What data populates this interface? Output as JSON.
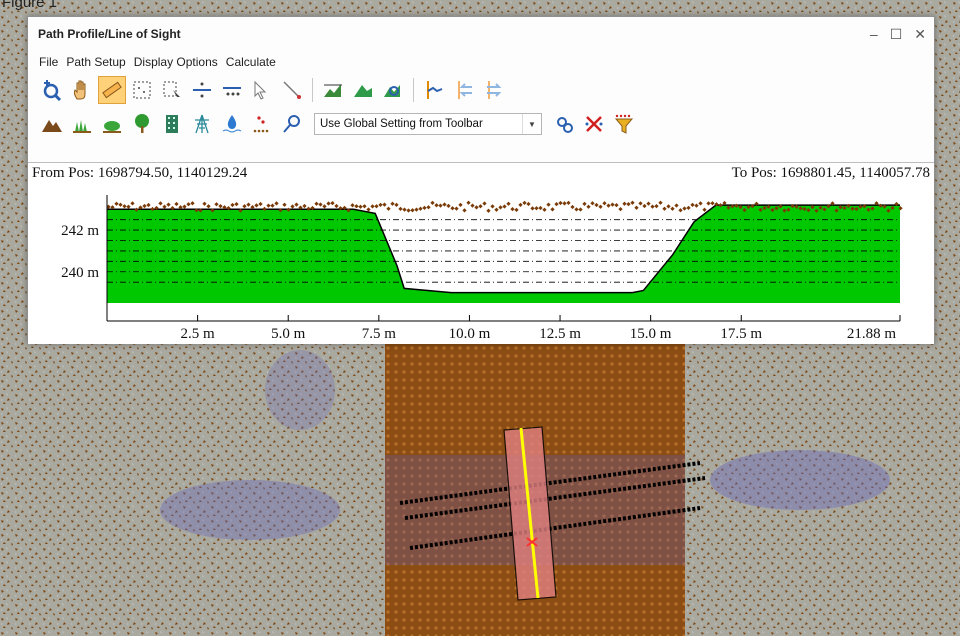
{
  "caption": "Figure 1",
  "window": {
    "title": "Path Profile/Line of Sight",
    "controls": {
      "minimize": "–",
      "maximize": "☐",
      "close": "✕"
    }
  },
  "menu": [
    "File",
    "Path Setup",
    "Display Options",
    "Calculate"
  ],
  "toolbar1": [
    {
      "icon": "zoom-plus-icon"
    },
    {
      "icon": "pan-hand-icon"
    },
    {
      "icon": "ruler-icon",
      "active": true
    },
    {
      "icon": "select-box-icon"
    },
    {
      "icon": "select-points-icon"
    },
    {
      "icon": "divide-icon"
    },
    {
      "icon": "divide-points-icon"
    },
    {
      "icon": "pointer-icon"
    },
    {
      "icon": "line-pointer-icon"
    },
    {
      "icon": "terrain-chart-icon"
    },
    {
      "icon": "terrain-fill-icon"
    },
    {
      "icon": "terrain-zoom-icon"
    },
    {
      "icon": "profile-line-icon"
    },
    {
      "icon": "profile-arrow-left-icon"
    },
    {
      "icon": "profile-arrow-right-icon"
    }
  ],
  "toolbar2": {
    "icons_left": [
      "terrain-icon",
      "grass-icon",
      "shrub-icon",
      "tree-icon",
      "building-icon",
      "tower-icon",
      "water-icon",
      "points-icon",
      "pin-icon"
    ],
    "dropdown_value": "Use Global Setting from Toolbar",
    "icons_right": [
      "settings-gear-icon",
      "clear-x-icon",
      "filter-icon"
    ]
  },
  "profile": {
    "from_pos": "From Pos: 1698794.50, 1140129.24",
    "to_pos": "To Pos: 1698801.45, 1140057.78",
    "y_ticks": [
      "242 m",
      "240 m"
    ],
    "x_ticks": [
      "2.5 m",
      "5.0 m",
      "7.5 m",
      "10.0 m",
      "12.5 m",
      "15.0 m",
      "17.5 m",
      "21.88 m"
    ],
    "colors": {
      "terrain": "#00c800",
      "points": "#7a3b06"
    }
  },
  "chart_data": {
    "type": "area",
    "title": "",
    "xlabel": "",
    "ylabel": "",
    "x_range": [
      0,
      21.88
    ],
    "y_range": [
      238.5,
      243.3
    ],
    "grid": true,
    "x": [
      0,
      6.8,
      7.4,
      8.0,
      8.2,
      9.5,
      11.0,
      13.0,
      14.5,
      14.8,
      15.6,
      16.2,
      16.8,
      21.88
    ],
    "y": [
      243.0,
      243.0,
      242.8,
      240.3,
      239.2,
      239.0,
      239.0,
      239.0,
      239.0,
      239.1,
      240.8,
      242.4,
      243.2,
      243.2
    ]
  }
}
